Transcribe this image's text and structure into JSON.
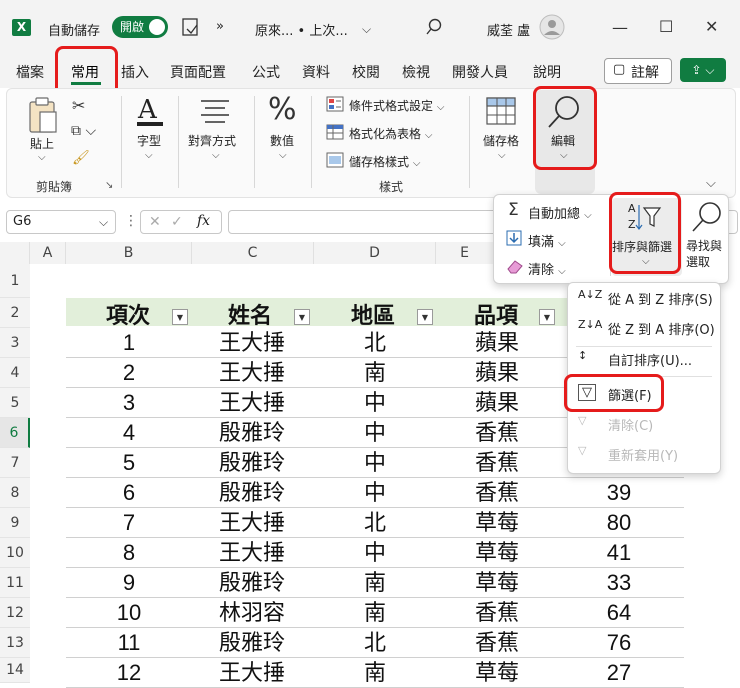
{
  "title_bar": {
    "app_logo": "X",
    "autosave_label": "自動儲存",
    "autosave_toggle": "開啟",
    "more": "»",
    "file_name": "原來... • 上次...",
    "user": "威荃 盧",
    "minimize": "—",
    "restore": "☐",
    "close": "✕"
  },
  "tabs": [
    "檔案",
    "常用",
    "插入",
    "頁面配置",
    "公式",
    "資料",
    "校閱",
    "檢視",
    "開發人員",
    "說明"
  ],
  "comment_button": "註解",
  "ribbon": {
    "clipboard_group": "剪貼簿",
    "paste_label": "貼上",
    "font_label": "字型",
    "align_label": "對齊方式",
    "number_label": "數值",
    "styles_group": "樣式",
    "style_items": [
      "條件式格式設定",
      "格式化為表格",
      "儲存格樣式"
    ],
    "cells_label": "儲存格",
    "edit_label": "編輯"
  },
  "edit_panel": {
    "autosum": "自動加總",
    "fill": "填滿",
    "clear": "清除",
    "sort_filter": "排序與篩選",
    "find_select": "尋找與選取"
  },
  "sort_menu": [
    {
      "label": "從 A 到 Z 排序(S)",
      "disabled": false
    },
    {
      "label": "從 Z 到 A 排序(O)",
      "disabled": false
    },
    {
      "label": "自訂排序(U)...",
      "disabled": false
    },
    {
      "label": "篩選(F)",
      "disabled": false
    },
    {
      "label": "清除(C)",
      "disabled": true
    },
    {
      "label": "重新套用(Y)",
      "disabled": true
    }
  ],
  "formula_bar": {
    "name_box": "G6",
    "fx": "fx",
    "cancel": "✕",
    "enter": "✓"
  },
  "columns": [
    "A",
    "B",
    "C",
    "D",
    "E"
  ],
  "rows": [
    "1",
    "2",
    "3",
    "4",
    "5",
    "6",
    "7",
    "8",
    "9",
    "10",
    "11",
    "12",
    "13",
    "14"
  ],
  "table": {
    "headers": [
      "項次",
      "姓名",
      "地區",
      "品項"
    ],
    "rows": [
      [
        "1",
        "王大捶",
        "北",
        "蘋果",
        ""
      ],
      [
        "2",
        "王大捶",
        "南",
        "蘋果",
        ""
      ],
      [
        "3",
        "王大捶",
        "中",
        "蘋果",
        ""
      ],
      [
        "4",
        "殷雅玲",
        "中",
        "香蕉",
        ""
      ],
      [
        "5",
        "殷雅玲",
        "中",
        "香蕉",
        ""
      ],
      [
        "6",
        "殷雅玲",
        "中",
        "香蕉",
        "39"
      ],
      [
        "7",
        "王大捶",
        "北",
        "草莓",
        "80"
      ],
      [
        "8",
        "王大捶",
        "中",
        "草莓",
        "41"
      ],
      [
        "9",
        "殷雅玲",
        "南",
        "草莓",
        "33"
      ],
      [
        "10",
        "林羽容",
        "南",
        "香蕉",
        "64"
      ],
      [
        "11",
        "殷雅玲",
        "北",
        "香蕉",
        "76"
      ],
      [
        "12",
        "王大捶",
        "南",
        "草莓",
        "27"
      ]
    ]
  },
  "colors": {
    "excel_green": "#107c41",
    "highlight_red": "#e51b1b",
    "header_fill": "#e2efda"
  }
}
